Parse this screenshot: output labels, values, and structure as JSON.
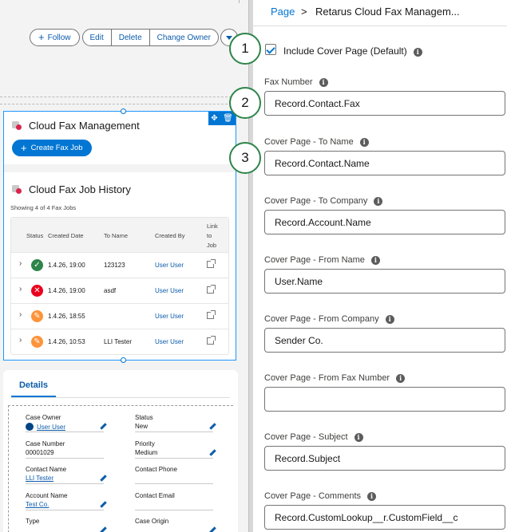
{
  "action_bar": {
    "follow_label": "Follow",
    "buttons": [
      "Edit",
      "Delete",
      "Change Owner"
    ]
  },
  "cloud_fax": {
    "title": "Cloud Fax Management",
    "create_label": "Create Fax Job"
  },
  "history": {
    "title": "Cloud Fax Job History",
    "subtitle": "Showing 4 of 4 Fax Jobs",
    "columns": [
      "Status",
      "Created Date",
      "To Name",
      "Created By",
      "Link to Job"
    ],
    "rows": [
      {
        "status": "success",
        "date": "1.4.26, 19:00",
        "to_name": "123123",
        "created_by": "User User"
      },
      {
        "status": "error",
        "date": "1.4.26, 19:00",
        "to_name": "asdf",
        "created_by": "User User"
      },
      {
        "status": "pending",
        "date": "1.4.26, 18:55",
        "to_name": "",
        "created_by": "User User"
      },
      {
        "status": "pending",
        "date": "1.4.26, 10:53",
        "to_name": "LLI Tester",
        "created_by": "User User"
      }
    ]
  },
  "details": {
    "tab_label": "Details",
    "fields": [
      {
        "label": "Case Owner",
        "value": "User User"
      },
      {
        "label": "Status",
        "value": "New"
      },
      {
        "label": "Case Number",
        "value": "00001029"
      },
      {
        "label": "Priority",
        "value": "Medium"
      },
      {
        "label": "Contact Name",
        "value": "LLI Tester"
      },
      {
        "label": "Contact Phone",
        "value": ""
      },
      {
        "label": "Account Name",
        "value": "Test Co."
      },
      {
        "label": "Contact Email",
        "value": ""
      },
      {
        "label": "Type",
        "value": ""
      },
      {
        "label": "Case Origin",
        "value": ""
      }
    ]
  },
  "panel": {
    "breadcrumb_link": "Page",
    "breadcrumb_sep": ">",
    "breadcrumb_current": "Retarus Cloud Fax Managem...",
    "include_cover_label": "Include Cover Page (Default)",
    "include_cover_checked": true,
    "fields": [
      {
        "label": "Fax Number",
        "value": "Record.Contact.Fax"
      },
      {
        "label": "Cover Page - To Name",
        "value": "Record.Contact.Name"
      },
      {
        "label": "Cover Page - To Company",
        "value": "Record.Account.Name"
      },
      {
        "label": "Cover Page - From Name",
        "value": "User.Name"
      },
      {
        "label": "Cover Page - From Company",
        "value": "Sender Co."
      },
      {
        "label": "Cover Page - From Fax Number",
        "value": ""
      },
      {
        "label": "Cover Page - Subject",
        "value": "Record.Subject"
      },
      {
        "label": "Cover Page - Comments",
        "value": "Record.CustomLookup__r.CustomField__c"
      }
    ]
  },
  "steps": [
    "1",
    "2",
    "3"
  ],
  "colors": {
    "accent": "#0176d3",
    "link": "#0b5cab",
    "step_ring": "#2e844a"
  },
  "icons": [
    "plus-icon",
    "chevron-down-icon",
    "move-icon",
    "trash-icon",
    "chevron-right-icon",
    "check-circle-icon",
    "error-circle-icon",
    "pending-circle-icon",
    "external-link-icon",
    "edit-icon",
    "info-icon",
    "checkbox-icon"
  ]
}
